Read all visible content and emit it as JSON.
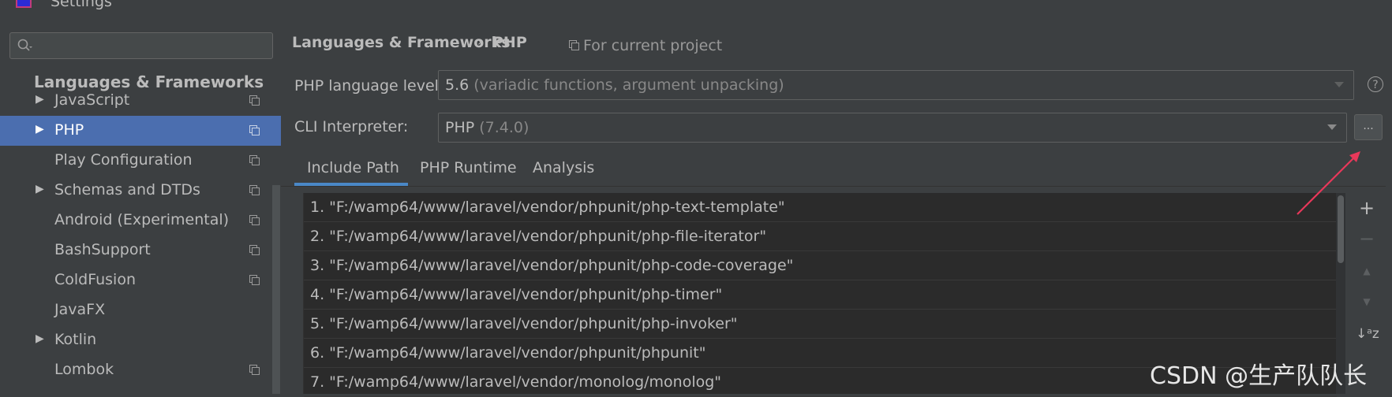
{
  "window": {
    "title": "Settings"
  },
  "sidebar": {
    "search": {
      "placeholder": ""
    },
    "group_header": "Languages & Frameworks",
    "items": [
      {
        "label": "JavaScript",
        "has_arrow": true,
        "has_copy": true,
        "selected": false
      },
      {
        "label": "PHP",
        "has_arrow": true,
        "has_copy": true,
        "selected": true
      },
      {
        "label": "Play Configuration",
        "has_arrow": false,
        "has_copy": true,
        "selected": false
      },
      {
        "label": "Schemas and DTDs",
        "has_arrow": true,
        "has_copy": true,
        "selected": false
      },
      {
        "label": "Android (Experimental)",
        "has_arrow": false,
        "has_copy": true,
        "selected": false
      },
      {
        "label": "BashSupport",
        "has_arrow": false,
        "has_copy": true,
        "selected": false
      },
      {
        "label": "ColdFusion",
        "has_arrow": false,
        "has_copy": true,
        "selected": false
      },
      {
        "label": "JavaFX",
        "has_arrow": false,
        "has_copy": false,
        "selected": false
      },
      {
        "label": "Kotlin",
        "has_arrow": true,
        "has_copy": false,
        "selected": false
      },
      {
        "label": "Lombok",
        "has_arrow": false,
        "has_copy": true,
        "selected": false
      }
    ]
  },
  "breadcrumb": {
    "parent": "Languages & Frameworks",
    "separator": "›",
    "current": "PHP",
    "scope": "For current project"
  },
  "php_level": {
    "label": "PHP language level:",
    "value": "5.6",
    "detail": "(variadic functions, argument unpacking)"
  },
  "cli": {
    "label": "CLI Interpreter:",
    "value": "PHP",
    "detail": "(7.4.0)",
    "browse_label": "..."
  },
  "tabs": [
    {
      "label": "Include Path",
      "active": true
    },
    {
      "label": "PHP Runtime",
      "active": false
    },
    {
      "label": "Analysis",
      "active": false
    }
  ],
  "include_paths": [
    "1. \"F:/wamp64/www/laravel/vendor/phpunit/php-text-template\"",
    "2. \"F:/wamp64/www/laravel/vendor/phpunit/php-file-iterator\"",
    "3. \"F:/wamp64/www/laravel/vendor/phpunit/php-code-coverage\"",
    "4. \"F:/wamp64/www/laravel/vendor/phpunit/php-timer\"",
    "5. \"F:/wamp64/www/laravel/vendor/phpunit/php-invoker\"",
    "6. \"F:/wamp64/www/laravel/vendor/phpunit/phpunit\"",
    "7. \"F:/wamp64/www/laravel/vendor/monolog/monolog\""
  ],
  "toolbar": {
    "add": "+",
    "remove": "−",
    "up": "▲",
    "down": "▼",
    "sort": "↓ᵃz"
  },
  "watermark": "CSDN @生产队队长",
  "colors": {
    "selection": "#4b6eaf",
    "annotation_arrow": "#e8385a",
    "tab_underline": "#4a88c7"
  }
}
